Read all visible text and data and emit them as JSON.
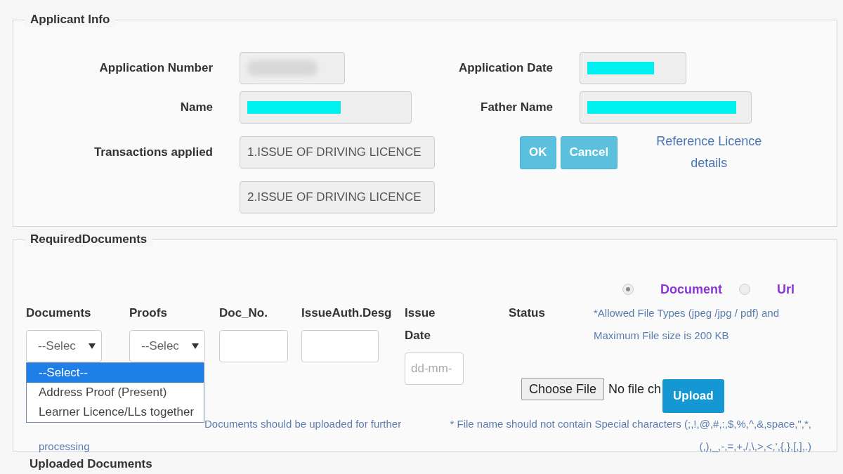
{
  "applicant_info": {
    "legend": "Applicant Info",
    "fields": [
      {
        "label": "Application Number",
        "kind": "blurred"
      },
      {
        "label": "Application Date",
        "kind": "highlighted"
      },
      {
        "label": "Name",
        "kind": "highlighted"
      },
      {
        "label": "Father Name",
        "kind": "highlighted"
      }
    ],
    "transactions": {
      "label": "Transactions applied",
      "values": [
        "1.ISSUE OF DRIVING LICENCE",
        "2.ISSUE OF DRIVING LICENCE"
      ]
    },
    "buttons": [
      "OK",
      "Cancel"
    ],
    "link": "Reference Licence details"
  },
  "required_documents": {
    "legend": "RequiredDocuments",
    "mode_options": [
      {
        "label": "Document",
        "selected": true
      },
      {
        "label": "Url",
        "selected": false
      }
    ],
    "columns": [
      "Documents",
      "Proofs",
      "Doc_No.",
      "IssueAuth.Desg",
      "Issue Date",
      "Status"
    ],
    "documents_select": {
      "value": "--Selec",
      "expanded": true,
      "options": [
        {
          "label": "--Select--",
          "selected": true
        },
        {
          "label": "Address Proof (Present)",
          "selected": false
        },
        {
          "label": "Learner Licence/LLs together",
          "selected": false
        }
      ]
    },
    "proofs_select": {
      "value": "--Selec"
    },
    "issue_date": {
      "placeholder": "dd-mm-"
    },
    "allowed_note": "*Allowed File Types (jpeg /jpg / pdf) and Maximum File size is 200 KB",
    "file": {
      "button": "Choose File",
      "status": "No file ch"
    },
    "upload": "Upload",
    "note": "Documents should be uploaded for further processing",
    "filename_note": "* File name should not contain Special characters (;,!,@,#,:,$,%,^,&,space,\",*,(,),_,-,=,+,/,\\,>,<,',{,},[,],.)"
  },
  "uploaded_documents": {
    "legend": "Uploaded Documents"
  }
}
